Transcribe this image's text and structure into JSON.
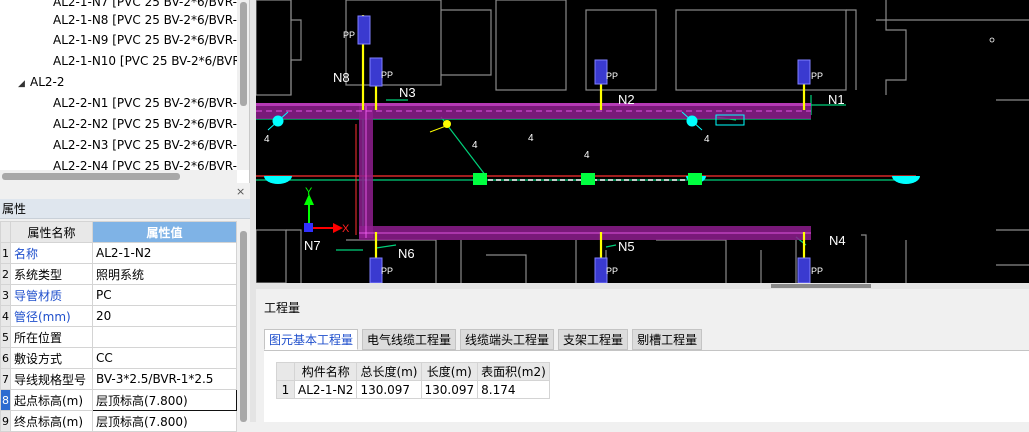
{
  "tree": {
    "items": [
      {
        "label": "AL2-1-N7 [PVC 25 BV-2*6/BVR-",
        "level": 2
      },
      {
        "label": "AL2-1-N8 [PVC 25 BV-2*6/BVR-",
        "level": 2
      },
      {
        "label": "AL2-1-N9 [PVC 25 BV-2*6/BVR-",
        "level": 2
      },
      {
        "label": "AL2-1-N10 [PVC 25 BV-2*6/BVR",
        "level": 2
      },
      {
        "label": "AL2-2",
        "level": 1
      },
      {
        "label": "AL2-2-N1 [PVC 25 BV-2*6/BVR-",
        "level": 2
      },
      {
        "label": "AL2-2-N2 [PVC 25 BV-2*6/BVR-",
        "level": 2
      },
      {
        "label": "AL2-2-N3 [PVC 25 BV-2*6/BVR-",
        "level": 2
      },
      {
        "label": "AL2-2-N4 [PVC 25 BV-2*6/BVR-",
        "level": 2
      }
    ],
    "close_glyph": "×"
  },
  "properties": {
    "title": "属性",
    "col_name": "属性名称",
    "col_value": "属性值",
    "rows": [
      {
        "idx": "1",
        "name": "名称",
        "value": "AL2-1-N2",
        "link": true
      },
      {
        "idx": "2",
        "name": "系统类型",
        "value": "照明系统",
        "link": false
      },
      {
        "idx": "3",
        "name": "导管材质",
        "value": "PC",
        "link": true
      },
      {
        "idx": "4",
        "name": "管径(mm)",
        "value": "20",
        "link": true
      },
      {
        "idx": "5",
        "name": "所在位置",
        "value": "",
        "link": false
      },
      {
        "idx": "6",
        "name": "敷设方式",
        "value": "CC",
        "link": false
      },
      {
        "idx": "7",
        "name": "导线规格型号",
        "value": "BV-3*2.5/BVR-1*2.5",
        "link": false
      },
      {
        "idx": "8",
        "name": "起点标高(m)",
        "value": "层顶标高(7.800)",
        "link": false,
        "selected": true
      },
      {
        "idx": "9",
        "name": "终点标高(m)",
        "value": "层顶标高(7.800)",
        "link": false
      }
    ]
  },
  "cad": {
    "labels": {
      "n1": "N1",
      "n2": "N2",
      "n3": "N3",
      "n4": "N4",
      "n5": "N5",
      "n6": "N6",
      "n7": "N7",
      "n8": "N8",
      "pp": "PP",
      "four": "4",
      "axis_x": "X",
      "axis_y": "Y"
    },
    "colors": {
      "conduit": "#8e1d8e",
      "wire_green": "#00d07a",
      "wire_red": "#ff3030",
      "wall": "#8a8a8a",
      "lamp": "#00ffff",
      "label": "#ffffff",
      "riser": "#ffff00"
    }
  },
  "quantities": {
    "title": "工程量",
    "tabs": [
      {
        "label": "图元基本工程量",
        "active": true
      },
      {
        "label": "电气线缆工程量",
        "active": false
      },
      {
        "label": "线缆端头工程量",
        "active": false
      },
      {
        "label": "支架工程量",
        "active": false
      },
      {
        "label": "剔槽工程量",
        "active": false
      }
    ],
    "table": {
      "headers": [
        "构件名称",
        "总长度(m)",
        "长度(m)",
        "表面积(m2)"
      ],
      "rows": [
        {
          "idx": "1",
          "cells": [
            "AL2-1-N2",
            "130.097",
            "130.097",
            "8.174"
          ]
        }
      ]
    }
  }
}
